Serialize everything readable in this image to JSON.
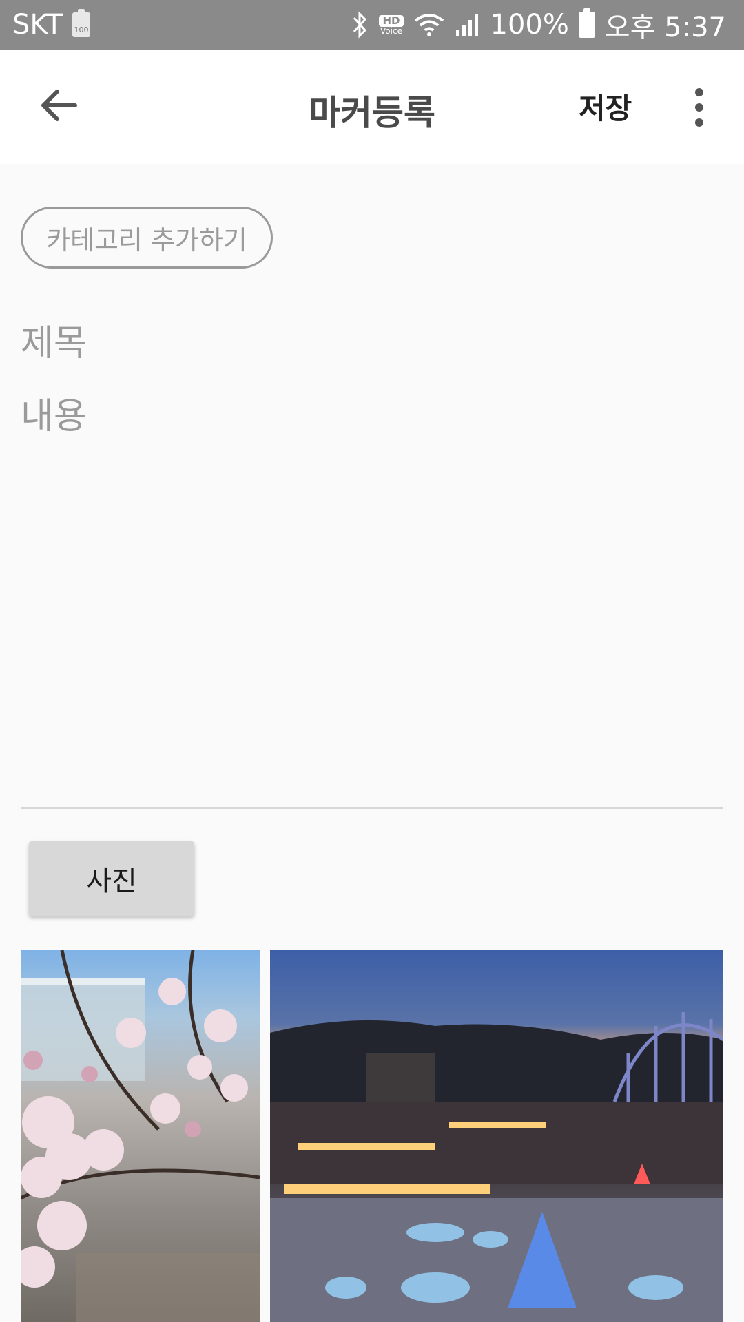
{
  "status_bar": {
    "carrier": "SKT",
    "battery_small": "100",
    "hd": "HD",
    "voice": "Voice",
    "battery_percent": "100%",
    "time": "오후 5:37"
  },
  "app_bar": {
    "title": "마커등록",
    "save_label": "저장"
  },
  "form": {
    "category_chip": "카테고리 추가하기",
    "title_placeholder": "제목",
    "content_placeholder": "내용",
    "photo_button": "사진"
  },
  "photos": [
    {
      "subject": "cherry-blossoms"
    },
    {
      "subject": "amusement-park-night-lights"
    }
  ]
}
